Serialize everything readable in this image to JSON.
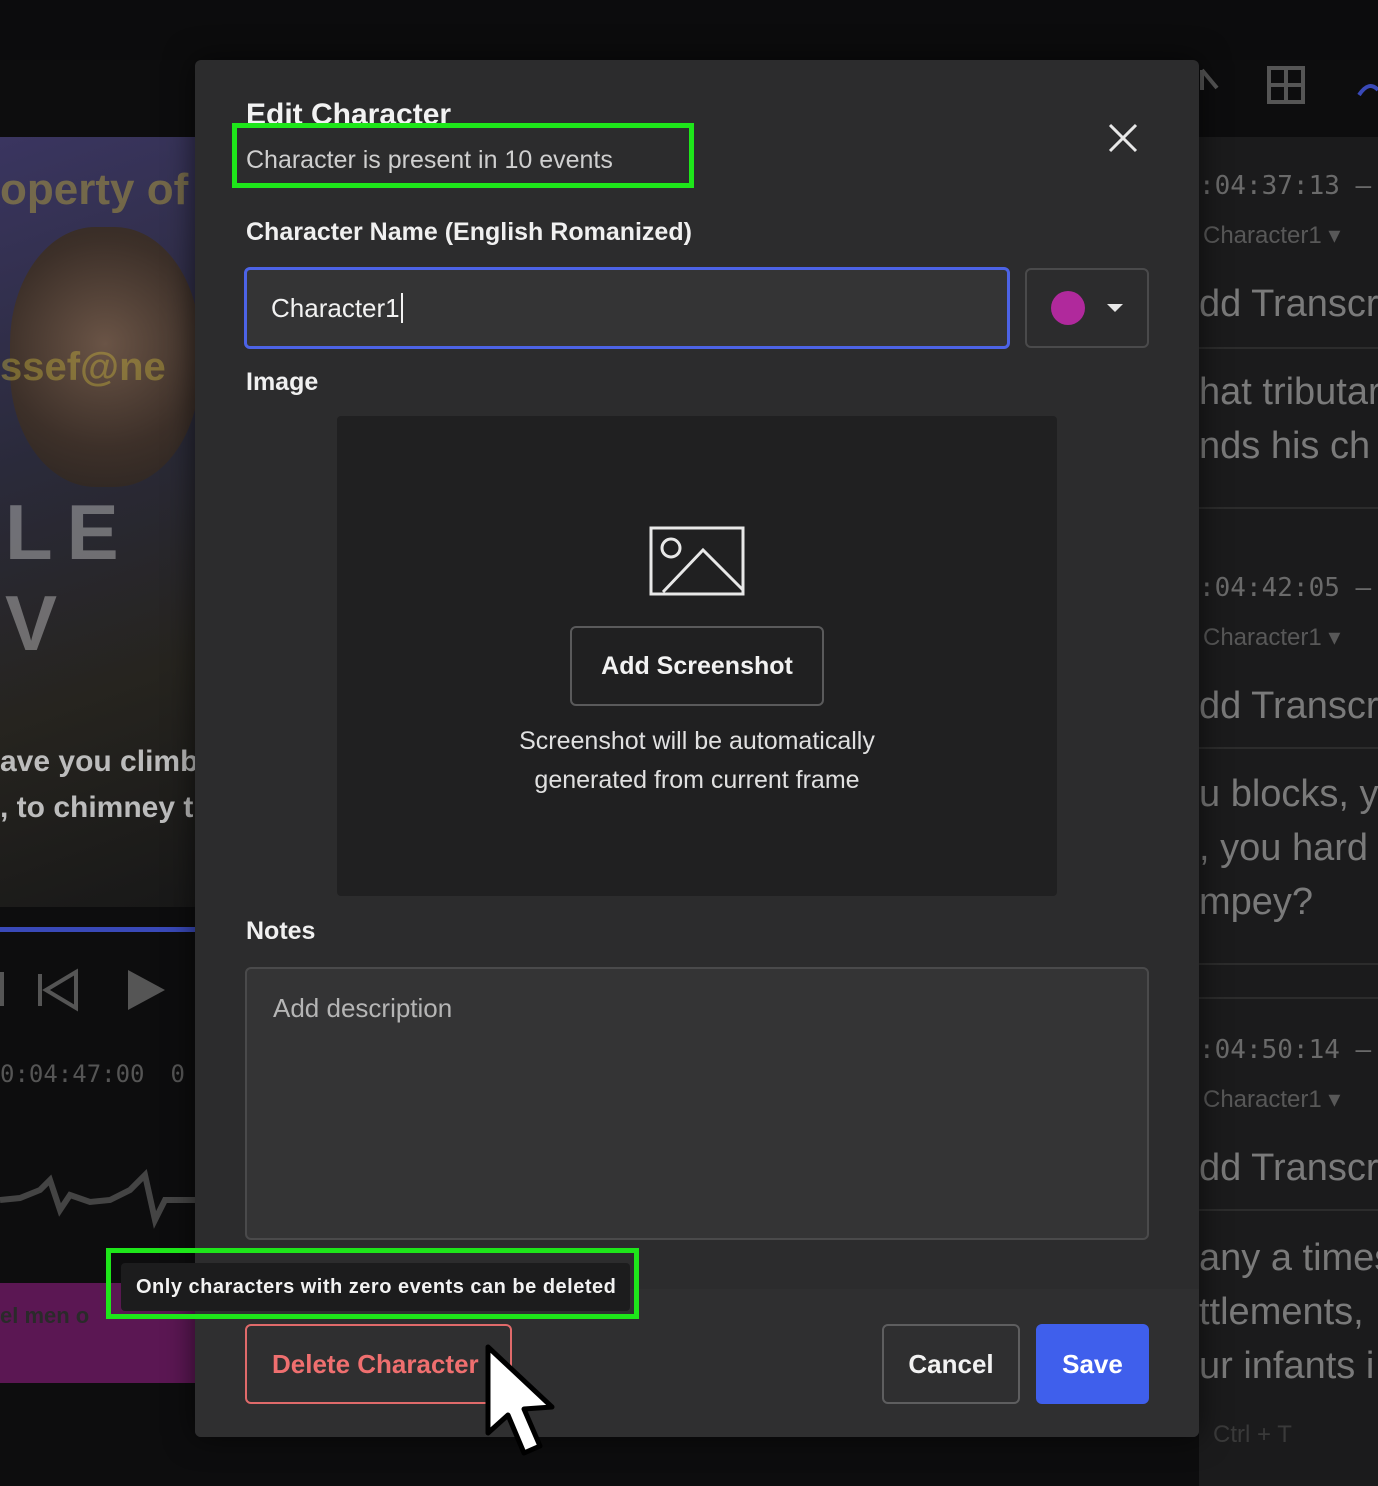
{
  "modal": {
    "title": "Edit Character",
    "subtitle": "Character is present in 10 events",
    "name_label": "Character Name (English Romanized)",
    "name_value": "Character1",
    "color": "#b0299c",
    "image_label": "Image",
    "add_screenshot_label": "Add Screenshot",
    "screenshot_hint_line1": "Screenshot will be automatically",
    "screenshot_hint_line2": "generated from current frame",
    "notes_label": "Notes",
    "notes_placeholder": "Add description",
    "notes_value": "",
    "delete_label": "Delete Character",
    "cancel_label": "Cancel",
    "save_label": "Save",
    "delete_tooltip": "Only characters with zero events can be deleted",
    "highlight_color": "#1ee61a"
  },
  "background": {
    "video_watermark_1": "operty of",
    "video_watermark_2": "ssef@ne",
    "video_text": "LE V",
    "subtitle_line1": "ave you climb",
    "subtitle_line2": ", to chimney t",
    "timecode": "0:04:47:00",
    "timecode_tail": "0",
    "magenta_text": "el men o",
    "events": [
      {
        "timecode": ":04:37:13  –",
        "character": "Character1",
        "lines": [
          "dd Transcri",
          "hat tributar",
          "nds his ch"
        ]
      },
      {
        "timecode": ":04:42:05  –",
        "character": "Character1",
        "lines": [
          "dd Transcri",
          "u blocks, y",
          ", you hard",
          "mpey?"
        ]
      },
      {
        "timecode": ":04:50:14  –",
        "character": "Character1",
        "lines": [
          "dd Transcri",
          "any a times",
          "ttlements,",
          "ur infants i"
        ]
      }
    ],
    "shortcut_hint": "Ctrl + T"
  }
}
